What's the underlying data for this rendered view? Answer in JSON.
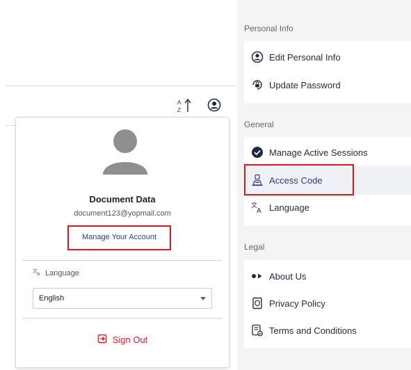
{
  "toolbar": {
    "sort_icon": "sort-az-icon",
    "user_icon": "account-circle-icon"
  },
  "profile_menu": {
    "user_name": "Document Data",
    "user_email": "document123@yopmail.com",
    "manage_account_label": "Manage Your Account",
    "language_label": "Language",
    "language_value": "English",
    "sign_out_label": "Sign Out",
    "accent_color": "#d81f2a",
    "highlight_color": "#e3171b"
  },
  "settings": {
    "sections": [
      {
        "label": "Personal Info",
        "items": [
          {
            "label": "Edit Personal Info",
            "icon": "person-circle-icon"
          },
          {
            "label": "Update Password",
            "icon": "lock-refresh-icon"
          }
        ]
      },
      {
        "label": "General",
        "items": [
          {
            "label": "Manage Active Sessions",
            "icon": "check-circle-icon"
          },
          {
            "label": "Access Code",
            "icon": "access-code-icon"
          },
          {
            "label": "Language",
            "icon": "translate-icon"
          }
        ]
      },
      {
        "label": "Legal",
        "items": [
          {
            "label": "About Us",
            "icon": "dots-play-icon"
          },
          {
            "label": "Privacy Policy",
            "icon": "shield-document-icon"
          },
          {
            "label": "Terms and Conditions",
            "icon": "terms-document-icon"
          }
        ]
      }
    ]
  }
}
